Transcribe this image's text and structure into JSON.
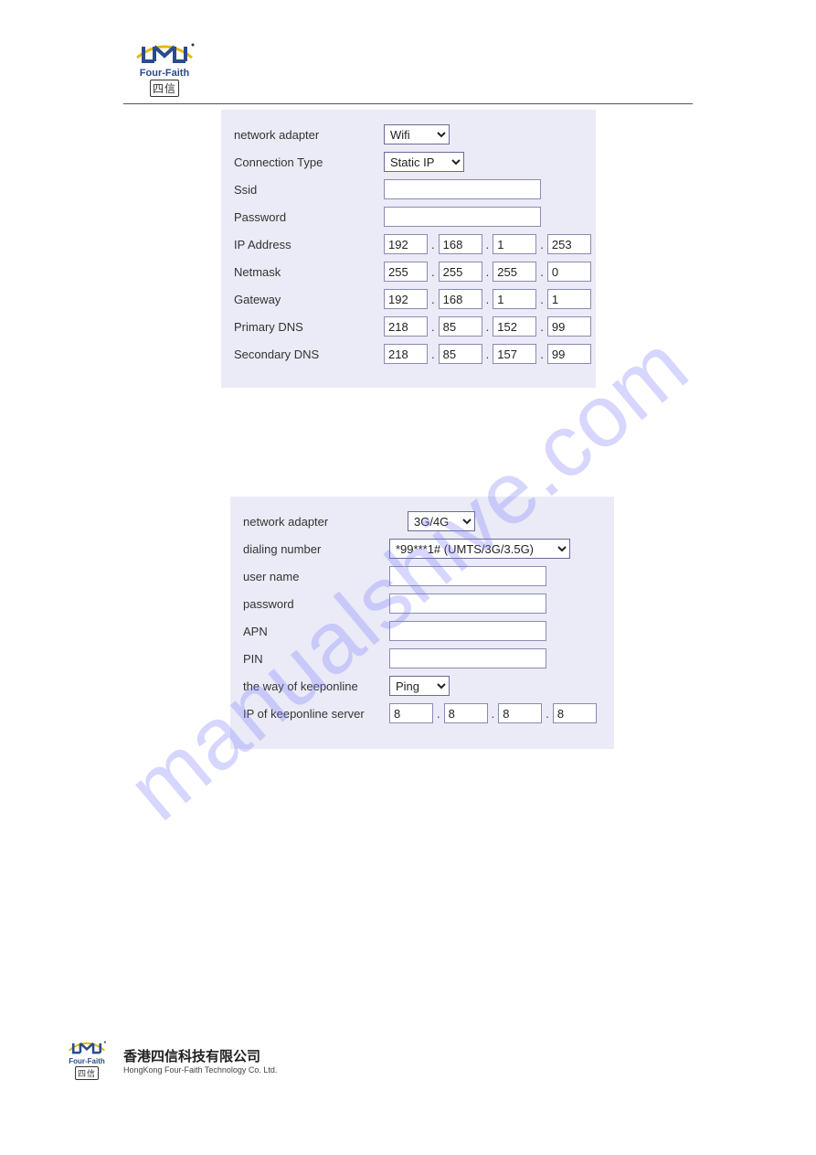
{
  "watermark": "manualshive.com",
  "logo": {
    "brand": "Four-Faith",
    "sub": "四信"
  },
  "panel1": {
    "labels": {
      "network_adapter": "network adapter",
      "connection_type": "Connection Type",
      "ssid": "Ssid",
      "password": "Password",
      "ip_address": "IP Address",
      "netmask": "Netmask",
      "gateway": "Gateway",
      "primary_dns": "Primary DNS",
      "secondary_dns": "Secondary DNS"
    },
    "values": {
      "network_adapter": "Wifi",
      "connection_type": "Static IP",
      "ssid": "",
      "password": "",
      "ip_address": [
        "192",
        "168",
        "1",
        "253"
      ],
      "netmask": [
        "255",
        "255",
        "255",
        "0"
      ],
      "gateway": [
        "192",
        "168",
        "1",
        "1"
      ],
      "primary_dns": [
        "218",
        "85",
        "152",
        "99"
      ],
      "secondary_dns": [
        "218",
        "85",
        "157",
        "99"
      ]
    }
  },
  "panel2": {
    "labels": {
      "network_adapter": "network adapter",
      "dialing_number": "dialing number",
      "user_name": "user name",
      "password": "password",
      "apn": "APN",
      "pin": "PIN",
      "keeponline_way": "the way of keeponline",
      "keeponline_ip": "IP of keeponline server"
    },
    "values": {
      "network_adapter": "3G/4G",
      "dialing_number": "*99***1# (UMTS/3G/3.5G)",
      "user_name": "",
      "password": "",
      "apn": "",
      "pin": "",
      "keeponline_way": "Ping",
      "keeponline_ip": [
        "8",
        "8",
        "8",
        "8"
      ]
    }
  },
  "footer": {
    "cn": "香港四信科技有限公司",
    "en": "HongKong Four-Faith Technology Co. Ltd."
  }
}
